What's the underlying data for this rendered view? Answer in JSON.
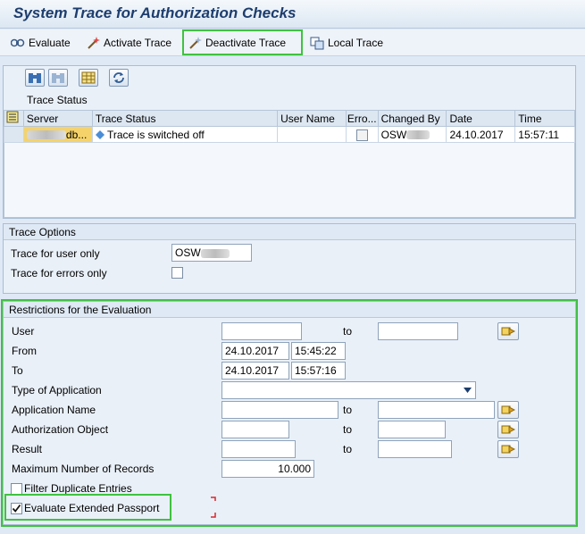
{
  "title": "System Trace for Authorization Checks",
  "toolbar": {
    "evaluate": "Evaluate",
    "activate": "Activate Trace",
    "deactivate": "Deactivate Trace",
    "local": "Local Trace"
  },
  "trace_status": {
    "header": "Trace Status",
    "columns": [
      "Server",
      "Trace Status",
      "User Name",
      "Erro...",
      "Changed By",
      "Date",
      "Time"
    ],
    "row": {
      "server": "db...",
      "status": "Trace is switched off",
      "user_name": "",
      "changed_by": "OSW",
      "date": "24.10.2017",
      "time": "15:57:11"
    }
  },
  "trace_options": {
    "header": "Trace Options",
    "user_only_label": "Trace for user only",
    "user_only_value": "OSW",
    "errors_only_label": "Trace for errors only"
  },
  "restrictions": {
    "header": "Restrictions for the Evaluation",
    "to_label": "to",
    "user_label": "User",
    "from_label": "From",
    "from_date": "24.10.2017",
    "from_time": "15:45:22",
    "to_row_label": "To",
    "to_date": "24.10.2017",
    "to_time": "15:57:16",
    "type_label": "Type of Application",
    "appname_label": "Application Name",
    "authobj_label": "Authorization Object",
    "result_label": "Result",
    "maxrec_label": "Maximum Number of Records",
    "maxrec_value": "10.000",
    "filter_dup_label": "Filter Duplicate Entries",
    "eval_passport_label": "Evaluate Extended Passport",
    "eval_passport_checked": true
  }
}
